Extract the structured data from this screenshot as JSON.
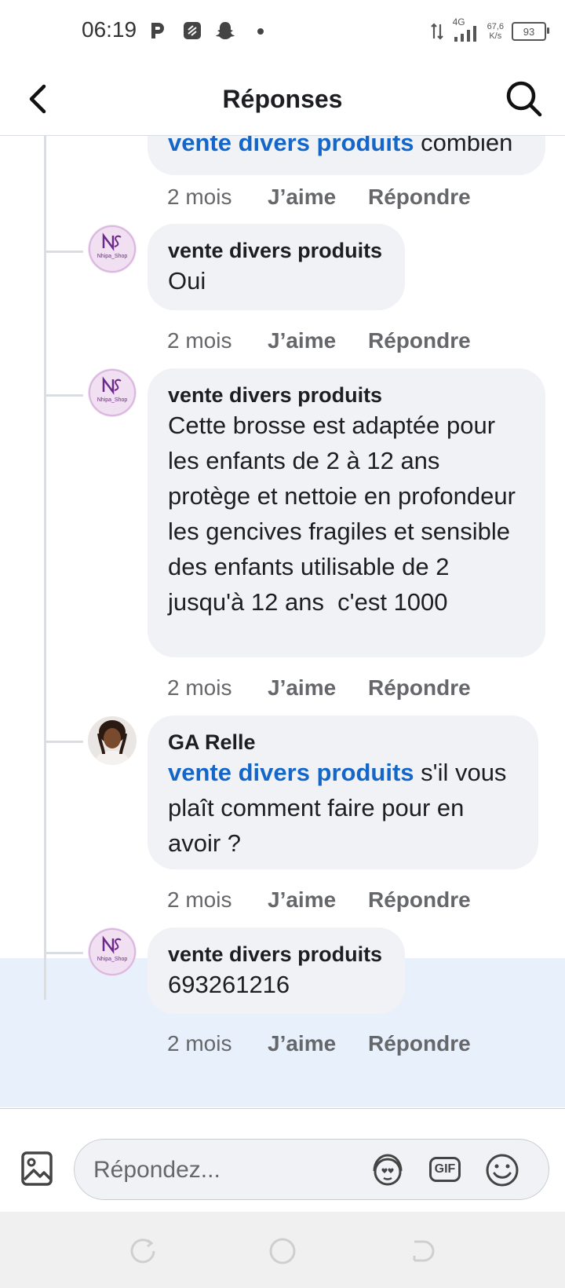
{
  "status_bar": {
    "time": "06:19",
    "network": "4G",
    "speed_value": "67,6",
    "speed_unit": "K/s",
    "battery": "93"
  },
  "header": {
    "title": "Réponses"
  },
  "comments": [
    {
      "mention": "vente divers produits",
      "text": " combien",
      "time": "2 mois",
      "like": "J’aime",
      "reply": "Répondre"
    },
    {
      "author": "vente divers produits",
      "text": "Oui",
      "time": "2 mois",
      "like": "J’aime",
      "reply": "Répondre"
    },
    {
      "author": "vente divers produits",
      "text": "Cette brosse est adaptée pour les enfants de 2 à 12 ans protège et nettoie en profondeur les gencives fragiles et sensible des enfants utilisable de 2 jusqu'à 12 ans  c'est 1000",
      "time": "2 mois",
      "like": "J’aime",
      "reply": "Répondre"
    },
    {
      "author": "GA Relle",
      "mention": "vente divers produits",
      "text": " s'il vous plaît comment faire pour en avoir ?",
      "time": "2 mois",
      "like": "J’aime",
      "reply": "Répondre"
    },
    {
      "author": "vente divers produits",
      "text": "693261216",
      "time": "2 mois",
      "like": "J’aime",
      "reply": "Répondre"
    }
  ],
  "logo_text": "Nhipa_Shop",
  "composer": {
    "placeholder": "Répondez...",
    "gif_label": "GIF"
  },
  "colors": {
    "mention": "#1467c9",
    "bubble": "#f0f2f5",
    "highlight": "#e8f1fb"
  }
}
